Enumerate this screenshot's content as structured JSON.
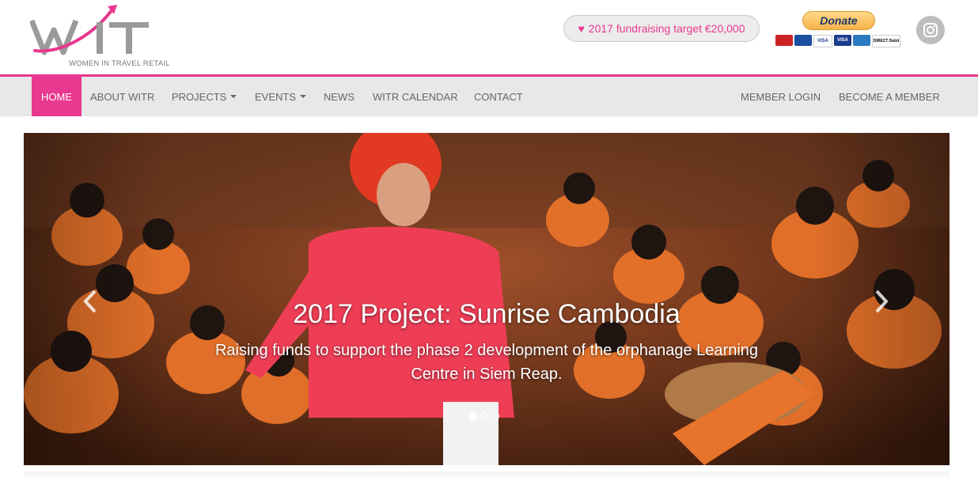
{
  "brand": {
    "logo_letters": "WIT",
    "logo_tagline": "WOMEN IN TRAVEL RETAIL",
    "accent": "#e8388f"
  },
  "header": {
    "fundraising_icon": "heart-icon",
    "fundraising_text": "2017 fundraising target €20,000",
    "donate_label": "Donate",
    "payment_cards": [
      "MasterCard",
      "Maestro",
      "VISA",
      "VISA",
      "AMEX",
      "DIRECT Debit"
    ],
    "social_icon": "instagram-icon"
  },
  "nav": {
    "left": [
      {
        "label": "HOME",
        "active": true
      },
      {
        "label": "ABOUT WITR"
      },
      {
        "label": "PROJECTS",
        "dropdown": true
      },
      {
        "label": "EVENTS",
        "dropdown": true
      },
      {
        "label": "NEWS"
      },
      {
        "label": "WITR CALENDAR"
      },
      {
        "label": "CONTACT"
      }
    ],
    "right": [
      {
        "label": "MEMBER LOGIN"
      },
      {
        "label": "BECOME A MEMBER"
      }
    ]
  },
  "carousel": {
    "slide_title": "2017 Project: Sunrise Cambodia",
    "slide_text": "Raising funds to support the phase 2 development of the orphanage Learning Centre in Siem Reap.",
    "slide_count": 3,
    "active_slide": 1,
    "prev_icon": "chevron-left-icon",
    "next_icon": "chevron-right-icon"
  }
}
